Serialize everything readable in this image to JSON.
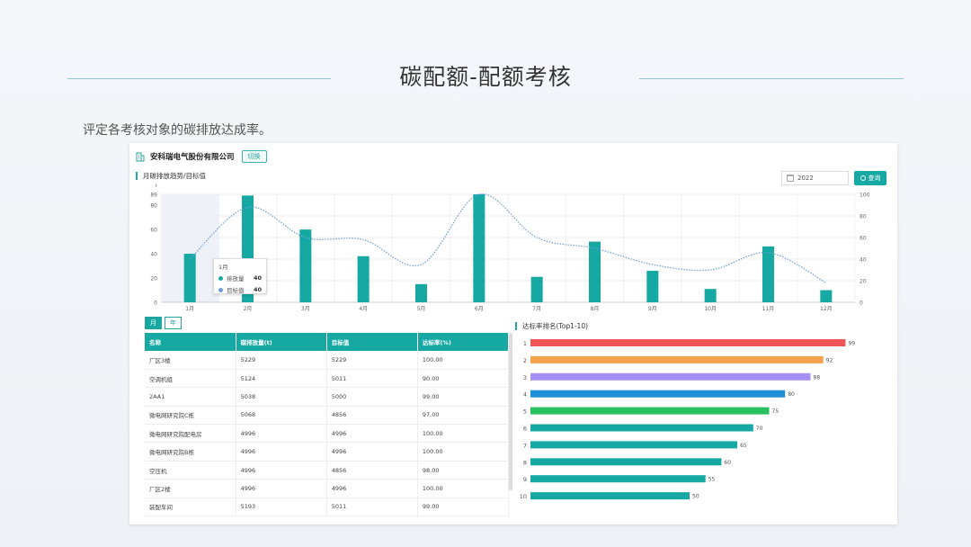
{
  "slide": {
    "title": "碳配额-配额考核",
    "subtitle": "评定各考核对象的碳排放达成率。"
  },
  "header": {
    "company": "安科瑞电气股份有限公司",
    "switch_label": "切换",
    "trend_title": "月碳排放趋势/目标值",
    "year_value": "2022",
    "query_label": "查询"
  },
  "tooltip": {
    "month": "1月",
    "rows": [
      {
        "label": "排放量",
        "value": "40"
      },
      {
        "label": "目标值",
        "value": "40"
      }
    ]
  },
  "toggles": {
    "month": "月",
    "year": "年"
  },
  "table": {
    "headers": [
      "名称",
      "碳排放量(t)",
      "目标值",
      "达标率(%)"
    ],
    "rows": [
      [
        "厂区3楼",
        "5229",
        "5229",
        "100.00"
      ],
      [
        "空调机组",
        "5124",
        "5011",
        "90.00"
      ],
      [
        "2AA1",
        "5038",
        "5000",
        "99.00"
      ],
      [
        "微电网研究院C栋",
        "5068",
        "4856",
        "97.00"
      ],
      [
        "微电网研究院配电房",
        "4996",
        "4996",
        "100.00"
      ],
      [
        "微电网研究院B栋",
        "4996",
        "4996",
        "100.00"
      ],
      [
        "空压机",
        "4996",
        "4856",
        "98.00"
      ],
      [
        "厂区2楼",
        "4996",
        "4996",
        "100.00"
      ],
      [
        "装配车间",
        "5193",
        "5011",
        "99.00"
      ]
    ]
  },
  "ranking_title": "达标率排名(Top1-10)",
  "colors": {
    "accent": "#16a8a3",
    "line": "#6a9fd6"
  },
  "chart_data": [
    {
      "type": "bar",
      "categories": [
        "1月",
        "2月",
        "3月",
        "4月",
        "5月",
        "6月",
        "7月",
        "8月",
        "9月",
        "10月",
        "11月",
        "12月"
      ],
      "series": [
        {
          "name": "排放量",
          "type": "bar",
          "values": [
            40,
            88,
            60,
            38,
            15,
            89,
            21,
            50,
            26,
            11,
            46,
            10
          ]
        },
        {
          "name": "目标值",
          "type": "line",
          "values": [
            40,
            88,
            60,
            58,
            35,
            100,
            60,
            50,
            35,
            30,
            46,
            18
          ]
        }
      ],
      "y_left_ticks": [
        "0",
        "20",
        "40",
        "60",
        "80",
        "89"
      ],
      "y_left_max": 89,
      "y_left_unit": "t",
      "y_right_ticks": [
        "0",
        "20",
        "40",
        "60",
        "80",
        "100"
      ],
      "y_right_max": 100,
      "highlight_category": "1月",
      "grid": true
    },
    {
      "type": "bar",
      "orientation": "horizontal",
      "title": "达标率排名(Top1-10)",
      "categories": [
        "1",
        "2",
        "3",
        "4",
        "5",
        "6",
        "7",
        "8",
        "9",
        "10"
      ],
      "values": [
        99,
        92,
        88,
        80,
        75,
        70,
        65,
        60,
        55,
        50
      ],
      "colors": [
        "#f05656",
        "#f5a24c",
        "#a58ef5",
        "#1e8fd6",
        "#27c25f",
        "#16a8a3",
        "#16a8a3",
        "#16a8a3",
        "#16a8a3",
        "#16a8a3"
      ],
      "xlim": [
        0,
        100
      ]
    }
  ]
}
